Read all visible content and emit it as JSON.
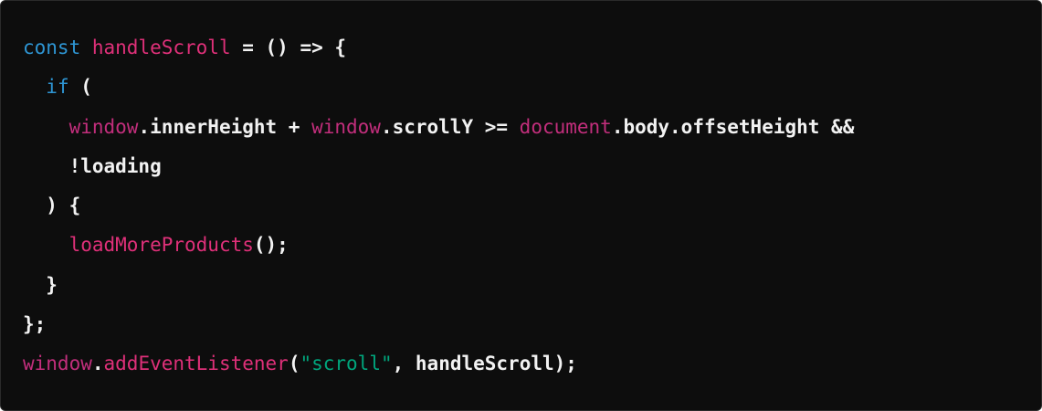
{
  "colors": {
    "background": "#0d0d0d",
    "keyword": "#2e95d3",
    "function": "#df3079",
    "global": "#c22e7c",
    "string": "#00a67d",
    "text": "#f2f2f2"
  },
  "code": {
    "language": "javascript",
    "lines": [
      {
        "indent": "",
        "tokens": [
          {
            "t": "kw",
            "v": "const"
          },
          {
            "t": "punc",
            "v": " "
          },
          {
            "t": "fn",
            "v": "handleScroll"
          },
          {
            "t": "punc",
            "v": " = () => {"
          }
        ]
      },
      {
        "indent": "  ",
        "tokens": [
          {
            "t": "kw",
            "v": "if"
          },
          {
            "t": "punc",
            "v": " ("
          }
        ]
      },
      {
        "indent": "    ",
        "tokens": [
          {
            "t": "gl",
            "v": "window"
          },
          {
            "t": "punc",
            "v": ".innerHeight + "
          },
          {
            "t": "gl",
            "v": "window"
          },
          {
            "t": "punc",
            "v": ".scrollY >= "
          },
          {
            "t": "gl",
            "v": "document"
          },
          {
            "t": "punc",
            "v": ".body.offsetHeight &&"
          }
        ]
      },
      {
        "indent": "    ",
        "tokens": [
          {
            "t": "punc",
            "v": "!loading"
          }
        ]
      },
      {
        "indent": "  ",
        "tokens": [
          {
            "t": "punc",
            "v": ") {"
          }
        ]
      },
      {
        "indent": "    ",
        "tokens": [
          {
            "t": "fn",
            "v": "loadMoreProducts"
          },
          {
            "t": "punc",
            "v": "();"
          }
        ]
      },
      {
        "indent": "  ",
        "tokens": [
          {
            "t": "punc",
            "v": "}"
          }
        ]
      },
      {
        "indent": "",
        "tokens": [
          {
            "t": "punc",
            "v": "};"
          }
        ]
      },
      {
        "indent": "",
        "tokens": [
          {
            "t": "gl",
            "v": "window"
          },
          {
            "t": "punc",
            "v": "."
          },
          {
            "t": "fn",
            "v": "addEventListener"
          },
          {
            "t": "punc",
            "v": "("
          },
          {
            "t": "str",
            "v": "\"scroll\""
          },
          {
            "t": "punc",
            "v": ", handleScroll);"
          }
        ]
      }
    ]
  }
}
